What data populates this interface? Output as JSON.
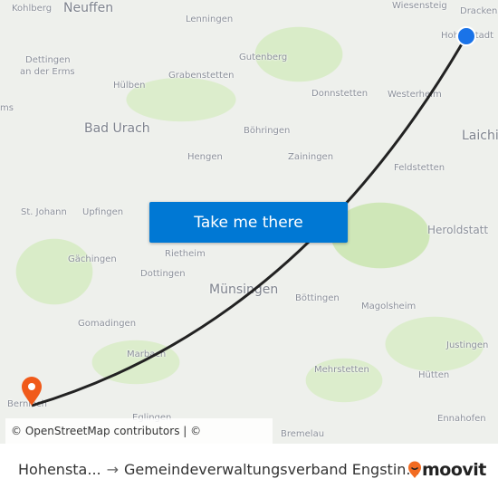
{
  "map": {
    "labels": [
      "Kohlberg",
      "Neuffen",
      "Lenningen",
      "Wiesensteig",
      "Drackenstein",
      "Hohenstadt",
      "Dettingen",
      "an der Erms",
      "Gutenberg",
      "Grabenstetten",
      "Hülben",
      "Donnstetten",
      "Westerheim",
      "ms",
      "Bad Urach",
      "Böhringen",
      "Laichingen",
      "Hengen",
      "Zainingen",
      "Feldstetten",
      "St. Johann",
      "Upfingen",
      "Heroldstatt",
      "Gächingen",
      "Rietheim",
      "Dottingen",
      "Münsingen",
      "Böttingen",
      "Magolsheim",
      "Gomadingen",
      "Marbach",
      "Justingen",
      "Mehrstetten",
      "Hütten",
      "Bernloch",
      "Eglingen",
      "Ennahofen",
      "Bremelau"
    ],
    "route_color": "#222222",
    "origin_color": "#1a73e8",
    "destination_color": "#f05a1a"
  },
  "cta": {
    "label": "Take me there"
  },
  "attribution": "© OpenStreetMap contributors | © OpenMapTiles",
  "footer": {
    "from": "Hohensta...",
    "arrow": "→",
    "to": "Gemeindeverwaltungsverband Engstin...",
    "brand": "moovit",
    "brand_color": "#f26b21"
  }
}
